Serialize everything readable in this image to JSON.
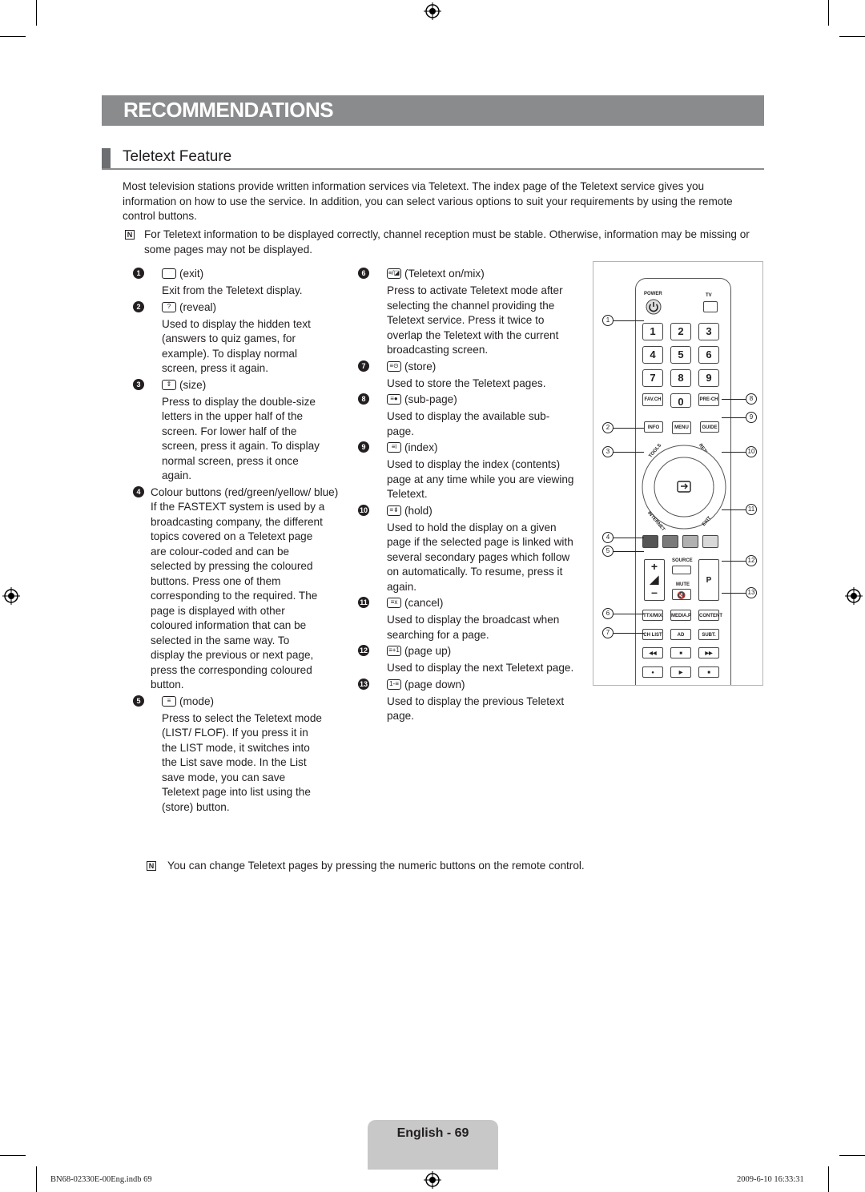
{
  "banner": {
    "title": "RECOMMENDATIONS",
    "color": "#8a8b8d"
  },
  "section": {
    "title": "Teletext Feature"
  },
  "intro": "Most television stations provide written information services via Teletext. The index page of the Teletext service gives you information on how to use the service. In addition, you can select various options to suit your requirements by using the remote control buttons.",
  "notes": [
    {
      "icon": "note-icon",
      "text": "For Teletext information to be displayed correctly, channel reception must be stable. Otherwise, information may be missing or some pages may not be displayed."
    },
    {
      "icon": "note-icon",
      "text": "You can change Teletext pages by pressing the numeric buttons on the remote control."
    }
  ],
  "left_items": [
    {
      "num": "1",
      "glyph": "",
      "label": "(exit)",
      "desc": "Exit from the Teletext display."
    },
    {
      "num": "2",
      "glyph": "?",
      "label": "(reveal)",
      "desc": "Used to display the hidden text (answers to quiz games, for example). To display normal screen, press it again."
    },
    {
      "num": "3",
      "glyph": "⇕",
      "label": "(size)",
      "desc": "Press to display the double-size letters in the upper half of the screen. For lower half of the screen, press it again. To display normal screen, press it once again."
    },
    {
      "num": "4",
      "glyph": null,
      "label": "Colour buttons (red/green/yellow/ blue)",
      "desc": "If the FASTEXT system is used by a broadcasting company, the different topics covered on a Teletext page are colour-coded and can be selected by pressing the coloured buttons. Press one of them corresponding to the required. The page is displayed with other coloured information that can be selected in the same way. To display the previous or next page, press the corresponding coloured button."
    },
    {
      "num": "5",
      "glyph": "≡",
      "label": "(mode)",
      "desc": "Press to select the Teletext mode (LIST/ FLOF). If you press it in the LIST mode, it switches into the List save mode. In the List save mode, you can save Teletext page into list using the (store) button."
    }
  ],
  "right_items": [
    {
      "num": "6",
      "glyph": "≡/◪",
      "label": "(Teletext on/mix)",
      "desc": "Press to activate Teletext mode after selecting the channel providing the Teletext service. Press it twice to overlap the Teletext with the current broadcasting screen."
    },
    {
      "num": "7",
      "glyph": "≡⊙",
      "label": "(store)",
      "desc": "Used to store the Teletext pages."
    },
    {
      "num": "8",
      "glyph": "≡●",
      "label": "(sub-page)",
      "desc": "Used to display the available sub-page."
    },
    {
      "num": "9",
      "glyph": "≡i",
      "label": "(index)",
      "desc": "Used to display the index (contents) page at any time while you are viewing Teletext."
    },
    {
      "num": "10",
      "glyph": "≡⇟",
      "label": "(hold)",
      "desc": "Used to hold the display on a given page if the selected page is linked with several secondary pages which follow on automatically. To resume, press it again."
    },
    {
      "num": "11",
      "glyph": "≡x",
      "label": "(cancel)",
      "desc": "Used to display the broadcast when searching for a page."
    },
    {
      "num": "12",
      "glyph": "≡+1",
      "label": "(page up)",
      "desc": "Used to display the next Teletext page."
    },
    {
      "num": "13",
      "glyph": "1-≡",
      "label": "(page down)",
      "desc": "Used to display the previous Teletext page."
    }
  ],
  "remote": {
    "power_label": "POWER",
    "tv_label": "TV",
    "digits": [
      "1",
      "2",
      "3",
      "4",
      "5",
      "6",
      "7",
      "8",
      "9"
    ],
    "fav_ch": "FAV.CH",
    "zero": "0",
    "pre_ch": "PRE-CH",
    "info": "INFO",
    "menu": "MENU",
    "guide": "GUIDE",
    "tools": "TOOLS",
    "return": "RETURN",
    "internet": "INTERNET",
    "exit": "EXIT",
    "source": "SOURCE",
    "mute": "MUTE",
    "p": "P",
    "ttx_mix": "TTX/MIX",
    "media_p": "MEDIA.P",
    "content": "CONTENT",
    "ch_list": "CH LIST",
    "ad": "AD",
    "subt": "SUBT.",
    "colour_buttons": [
      "#555555",
      "#7a7a7a",
      "#b0b0b0",
      "#d8d8d8"
    ],
    "callouts_left": [
      "1",
      "2",
      "3",
      "4",
      "5",
      "6",
      "7"
    ],
    "callouts_right": [
      "8",
      "9",
      "10",
      "11",
      "12",
      "13"
    ]
  },
  "footer": {
    "page_label": "English - 69",
    "file": "BN68-02330E-00Eng.indb   69",
    "timestamp": "2009-6-10   16:33:31"
  }
}
